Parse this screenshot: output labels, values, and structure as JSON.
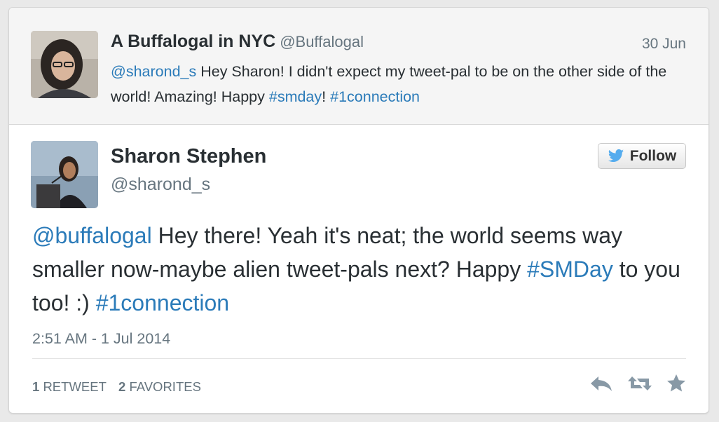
{
  "parent_tweet": {
    "name": "A Buffalogal in NYC",
    "handle": "@Buffalogal",
    "date": "30 Jun",
    "text_mention": "@sharond_s",
    "text_part1": " Hey Sharon! I didn't expect my tweet-pal to be on the other side of the world! Amazing! Happy ",
    "hashtag1": "#smday",
    "text_part2": "! ",
    "hashtag2": "#1connection",
    "avatar_icon": "user-photo-avatar"
  },
  "main_tweet": {
    "name": "Sharon Stephen",
    "handle": "@sharond_s",
    "follow_label": "Follow",
    "text_mention": "@buffalogal",
    "text_part1": " Hey there! Yeah it's neat; the world seems way smaller now-maybe alien tweet-pals next? Happy ",
    "hashtag1": "#SMDay",
    "text_part2": " to you too! :) ",
    "hashtag2": "#1connection",
    "timestamp": "2:51 AM - 1 Jul 2014",
    "retweets_count": "1",
    "retweets_label": "RETWEET",
    "favorites_count": "2",
    "favorites_label": "FAVORITES",
    "avatar_icon": "user-photo-avatar",
    "follow_icon": "twitter-bird-icon",
    "actions": [
      "reply-icon",
      "retweet-icon",
      "favorite-star-icon"
    ]
  },
  "colors": {
    "link": "#2b7bb9",
    "text": "#292f33",
    "muted": "#66757f",
    "parent_bg": "#f5f5f5"
  }
}
